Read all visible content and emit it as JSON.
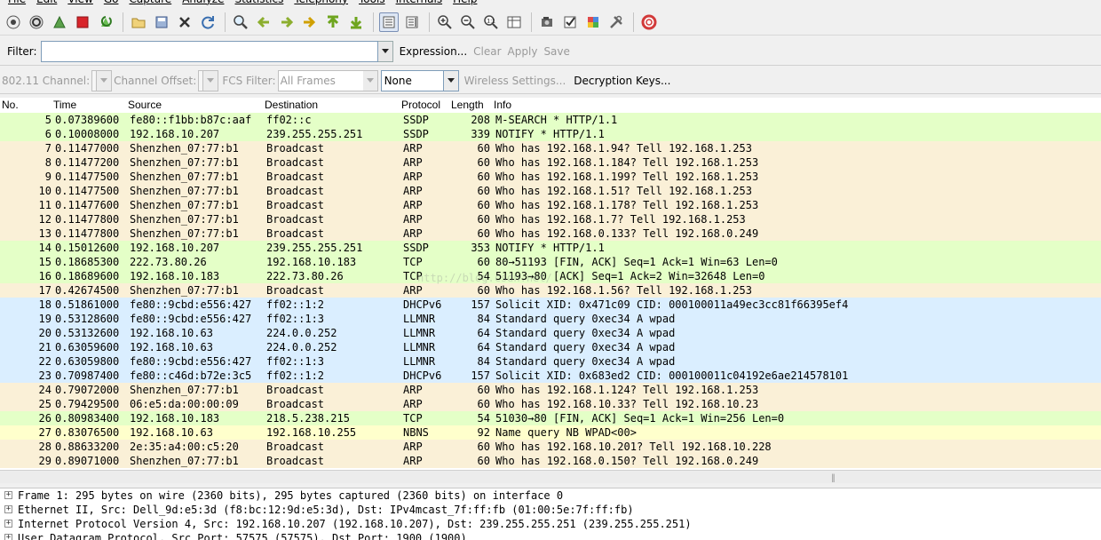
{
  "menu": [
    "File",
    "Edit",
    "View",
    "Go",
    "Capture",
    "Analyze",
    "Statistics",
    "Telephony",
    "Tools",
    "Internals",
    "Help"
  ],
  "filter": {
    "label": "Filter:",
    "value": "",
    "expression": "Expression...",
    "clear": "Clear",
    "apply": "Apply",
    "save": "Save"
  },
  "wireless": {
    "channel_label": "802.11 Channel:",
    "offset_label": "Channel Offset:",
    "fcs_label": "FCS Filter:",
    "fcs_value": "All Frames",
    "decrypt_value": "None",
    "settings": "Wireless Settings...",
    "keys": "Decryption Keys..."
  },
  "columns": {
    "no": "No.",
    "time": "Time",
    "source": "Source",
    "destination": "Destination",
    "protocol": "Protocol",
    "length": "Length",
    "info": "Info"
  },
  "colors": {
    "ssdp": "#e4ffc7",
    "arp": "#faf0d7",
    "tcp": "#e7e6ff",
    "dhcpv6": "#daeeff",
    "nbns": "#ffffcc"
  },
  "packets": [
    {
      "no": "5",
      "time": "0.07389600",
      "src": "fe80::f1bb:b87c:aaf",
      "dst": "ff02::c",
      "proto": "SSDP",
      "len": "208",
      "info": "M-SEARCH * HTTP/1.1",
      "bg": "#e4ffc7"
    },
    {
      "no": "6",
      "time": "0.10008000",
      "src": "192.168.10.207",
      "dst": "239.255.255.251",
      "proto": "SSDP",
      "len": "339",
      "info": "NOTIFY * HTTP/1.1",
      "bg": "#e4ffc7"
    },
    {
      "no": "7",
      "time": "0.11477000",
      "src": "Shenzhen_07:77:b1",
      "dst": "Broadcast",
      "proto": "ARP",
      "len": "60",
      "info": "Who has 192.168.1.94?  Tell 192.168.1.253",
      "bg": "#faf0d7"
    },
    {
      "no": "8",
      "time": "0.11477200",
      "src": "Shenzhen_07:77:b1",
      "dst": "Broadcast",
      "proto": "ARP",
      "len": "60",
      "info": "Who has 192.168.1.184?  Tell 192.168.1.253",
      "bg": "#faf0d7"
    },
    {
      "no": "9",
      "time": "0.11477500",
      "src": "Shenzhen_07:77:b1",
      "dst": "Broadcast",
      "proto": "ARP",
      "len": "60",
      "info": "Who has 192.168.1.199?  Tell 192.168.1.253",
      "bg": "#faf0d7"
    },
    {
      "no": "10",
      "time": "0.11477500",
      "src": "Shenzhen_07:77:b1",
      "dst": "Broadcast",
      "proto": "ARP",
      "len": "60",
      "info": "Who has 192.168.1.51?  Tell 192.168.1.253",
      "bg": "#faf0d7"
    },
    {
      "no": "11",
      "time": "0.11477600",
      "src": "Shenzhen_07:77:b1",
      "dst": "Broadcast",
      "proto": "ARP",
      "len": "60",
      "info": "Who has 192.168.1.178?  Tell 192.168.1.253",
      "bg": "#faf0d7"
    },
    {
      "no": "12",
      "time": "0.11477800",
      "src": "Shenzhen_07:77:b1",
      "dst": "Broadcast",
      "proto": "ARP",
      "len": "60",
      "info": "Who has 192.168.1.7?  Tell 192.168.1.253",
      "bg": "#faf0d7"
    },
    {
      "no": "13",
      "time": "0.11477800",
      "src": "Shenzhen_07:77:b1",
      "dst": "Broadcast",
      "proto": "ARP",
      "len": "60",
      "info": "Who has 192.168.0.133?  Tell 192.168.0.249",
      "bg": "#faf0d7"
    },
    {
      "no": "14",
      "time": "0.15012600",
      "src": "192.168.10.207",
      "dst": "239.255.255.251",
      "proto": "SSDP",
      "len": "353",
      "info": "NOTIFY * HTTP/1.1",
      "bg": "#e4ffc7"
    },
    {
      "no": "15",
      "time": "0.18685300",
      "src": "222.73.80.26",
      "dst": "192.168.10.183",
      "proto": "TCP",
      "len": "60",
      "info": "80→51193 [FIN, ACK] Seq=1 Ack=1 Win=63 Len=0",
      "bg": "#e4ffc7"
    },
    {
      "no": "16",
      "time": "0.18689600",
      "src": "192.168.10.183",
      "dst": "222.73.80.26",
      "proto": "TCP",
      "len": "54",
      "info": "51193→80 [ACK] Seq=1 Ack=2 Win=32648 Len=0",
      "bg": "#e4ffc7"
    },
    {
      "no": "17",
      "time": "0.42674500",
      "src": "Shenzhen_07:77:b1",
      "dst": "Broadcast",
      "proto": "ARP",
      "len": "60",
      "info": "Who has 192.168.1.56?  Tell 192.168.1.253",
      "bg": "#faf0d7"
    },
    {
      "no": "18",
      "time": "0.51861000",
      "src": "fe80::9cbd:e556:427",
      "dst": "ff02::1:2",
      "proto": "DHCPv6",
      "len": "157",
      "info": "Solicit XID: 0x471c09 CID: 000100011a49ec3cc81f66395ef4",
      "bg": "#daeeff"
    },
    {
      "no": "19",
      "time": "0.53128600",
      "src": "fe80::9cbd:e556:427",
      "dst": "ff02::1:3",
      "proto": "LLMNR",
      "len": "84",
      "info": "Standard query 0xec34  A wpad",
      "bg": "#daeeff"
    },
    {
      "no": "20",
      "time": "0.53132600",
      "src": "192.168.10.63",
      "dst": "224.0.0.252",
      "proto": "LLMNR",
      "len": "64",
      "info": "Standard query 0xec34  A wpad",
      "bg": "#daeeff"
    },
    {
      "no": "21",
      "time": "0.63059600",
      "src": "192.168.10.63",
      "dst": "224.0.0.252",
      "proto": "LLMNR",
      "len": "64",
      "info": "Standard query 0xec34  A wpad",
      "bg": "#daeeff"
    },
    {
      "no": "22",
      "time": "0.63059800",
      "src": "fe80::9cbd:e556:427",
      "dst": "ff02::1:3",
      "proto": "LLMNR",
      "len": "84",
      "info": "Standard query 0xec34  A wpad",
      "bg": "#daeeff"
    },
    {
      "no": "23",
      "time": "0.70987400",
      "src": "fe80::c46d:b72e:3c5",
      "dst": "ff02::1:2",
      "proto": "DHCPv6",
      "len": "157",
      "info": "Solicit XID: 0x683ed2 CID: 000100011c04192e6ae214578101",
      "bg": "#daeeff"
    },
    {
      "no": "24",
      "time": "0.79072000",
      "src": "Shenzhen_07:77:b1",
      "dst": "Broadcast",
      "proto": "ARP",
      "len": "60",
      "info": "Who has 192.168.1.124?  Tell 192.168.1.253",
      "bg": "#faf0d7"
    },
    {
      "no": "25",
      "time": "0.79429500",
      "src": "06:e5:da:00:00:09",
      "dst": "Broadcast",
      "proto": "ARP",
      "len": "60",
      "info": "Who has 192.168.10.33?  Tell 192.168.10.23",
      "bg": "#faf0d7"
    },
    {
      "no": "26",
      "time": "0.80983400",
      "src": "192.168.10.183",
      "dst": "218.5.238.215",
      "proto": "TCP",
      "len": "54",
      "info": "51030→80 [FIN, ACK] Seq=1 Ack=1 Win=256 Len=0",
      "bg": "#e4ffc7"
    },
    {
      "no": "27",
      "time": "0.83076500",
      "src": "192.168.10.63",
      "dst": "192.168.10.255",
      "proto": "NBNS",
      "len": "92",
      "info": "Name query NB WPAD<00>",
      "bg": "#ffffcc"
    },
    {
      "no": "28",
      "time": "0.88633200",
      "src": "2e:35:a4:00:c5:20",
      "dst": "Broadcast",
      "proto": "ARP",
      "len": "60",
      "info": "Who has 192.168.10.201?  Tell 192.168.10.228",
      "bg": "#faf0d7"
    },
    {
      "no": "29",
      "time": "0.89071000",
      "src": "Shenzhen_07:77:b1",
      "dst": "Broadcast",
      "proto": "ARP",
      "len": "60",
      "info": "Who has 192.168.0.150?  Tell 192.168.0.249",
      "bg": "#faf0d7"
    }
  ],
  "details": [
    "Frame 1: 295 bytes on wire (2360 bits), 295 bytes captured (2360 bits) on interface 0",
    "Ethernet II, Src: Dell_9d:e5:3d (f8:bc:12:9d:e5:3d), Dst: IPv4mcast_7f:ff:fb (01:00:5e:7f:ff:fb)",
    "Internet Protocol Version 4, Src: 192.168.10.207 (192.168.10.207), Dst: 239.255.255.251 (239.255.255.251)",
    "User Datagram Protocol, Src Port: 57575 (57575), Dst Port: 1900 (1900)"
  ],
  "watermark": "http://blog.csdn.net/"
}
